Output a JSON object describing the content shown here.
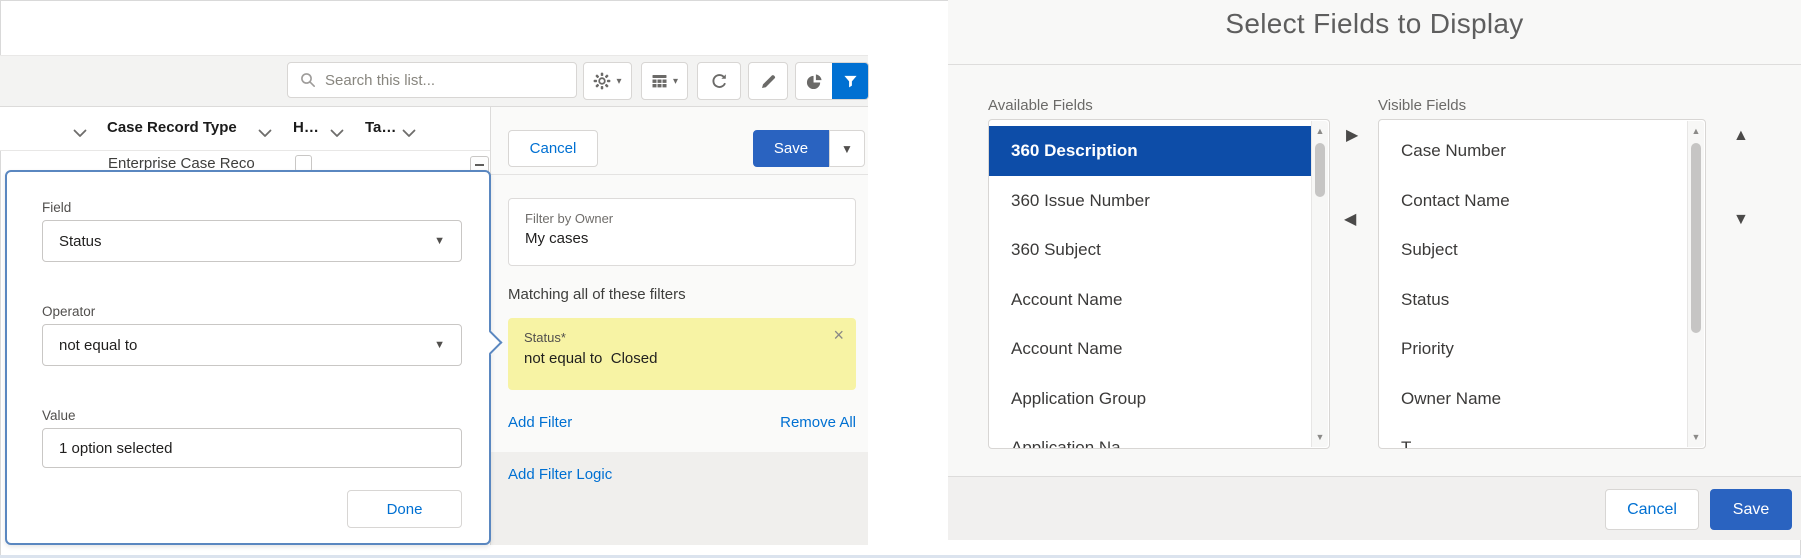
{
  "colors": {
    "brand_blue": "#0070d2",
    "save_blue": "#2a63c0",
    "selected_row_blue": "#0d4da8",
    "chip_yellow": "#f7f3a4",
    "link_blue": "#0070d2"
  },
  "left_panel": {
    "toolbar": {
      "search_placeholder": "Search this list..."
    },
    "table": {
      "columns": [
        "Case Record Type",
        "H…",
        "Ta…"
      ],
      "row_text": "Enterprise Case Reco"
    },
    "filter_panel": {
      "cancel_label": "Cancel",
      "save_label": "Save",
      "owner_label": "Filter by Owner",
      "owner_value": "My cases",
      "matching_text": "Matching all of these filters",
      "chip_field": "Status*",
      "chip_condition": "not equal to  Closed",
      "add_filter_label": "Add Filter",
      "remove_all_label": "Remove All",
      "add_filter_logic_label": "Add Filter Logic"
    },
    "popover": {
      "field_label": "Field",
      "field_value": "Status",
      "operator_label": "Operator",
      "operator_value": "not equal to",
      "value_label": "Value",
      "value_text": "1 option selected",
      "done_label": "Done"
    }
  },
  "dialog": {
    "title": "Select Fields to Display",
    "available_label": "Available Fields",
    "available_items": [
      "360 Description",
      "360 Issue Number",
      "360 Subject",
      "Account Name",
      "Account Name",
      "Application Group",
      "Application Na"
    ],
    "available_selected_index": 0,
    "visible_label": "Visible Fields",
    "visible_items": [
      "Case Number",
      "Contact Name",
      "Subject",
      "Status",
      "Priority",
      "Owner Name",
      "T"
    ],
    "cancel_label": "Cancel",
    "save_label": "Save"
  }
}
